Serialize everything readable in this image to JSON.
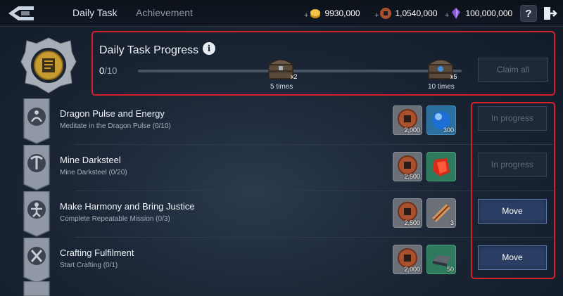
{
  "header": {
    "tabs": [
      {
        "label": "Daily Task",
        "active": true
      },
      {
        "label": "Achievement",
        "active": false
      }
    ],
    "currencies": [
      {
        "name": "gold",
        "value": "9930,000",
        "icon": "gold-coin-icon",
        "color": "#e7b63a"
      },
      {
        "name": "copper",
        "value": "1,0540,000",
        "icon": "copper-coin-icon",
        "color": "#b05a3a"
      },
      {
        "name": "crystal",
        "value": "100,000,000",
        "icon": "purple-crystal-icon",
        "color": "#8a5ad6"
      }
    ],
    "help_label": "?"
  },
  "progress": {
    "title": "Daily Task Progress",
    "info_label": "i",
    "completed": "0",
    "total": "/10",
    "milestones": [
      {
        "label": "5 times",
        "multiplier": "x2"
      },
      {
        "label": "10 times",
        "multiplier": "x5"
      }
    ],
    "claim_label": "Claim all"
  },
  "tasks": [
    {
      "title": "Dragon Pulse and Energy",
      "subtitle": "Meditate in the Dragon Pulse (0/10)",
      "rewards": [
        {
          "icon": "copper-coin-icon",
          "qty": "2,000"
        },
        {
          "icon": "blue-orb-icon",
          "qty": "300"
        }
      ],
      "button": "In progress",
      "state": "in-progress"
    },
    {
      "title": "Mine Darksteel",
      "subtitle": "Mine Darksteel (0/20)",
      "rewards": [
        {
          "icon": "copper-coin-icon",
          "qty": "2,500"
        },
        {
          "icon": "red-crystal-icon",
          "qty": ""
        }
      ],
      "button": "In progress",
      "state": "in-progress"
    },
    {
      "title": "Make Harmony and Bring Justice",
      "subtitle": "Complete Repeatable Mission (0/3)",
      "rewards": [
        {
          "icon": "copper-coin-icon",
          "qty": "2,500"
        },
        {
          "icon": "scroll-icon",
          "qty": "3"
        }
      ],
      "button": "Move",
      "state": "move"
    },
    {
      "title": "Crafting Fulfilment",
      "subtitle": "Start Crafting (0/1)",
      "rewards": [
        {
          "icon": "copper-coin-icon",
          "qty": "2,000"
        },
        {
          "icon": "darksteel-ingot-icon",
          "qty": "50"
        }
      ],
      "button": "Move",
      "state": "move"
    }
  ],
  "colors": {
    "highlight": "#d8202c",
    "move_button": "#2b3e63"
  }
}
